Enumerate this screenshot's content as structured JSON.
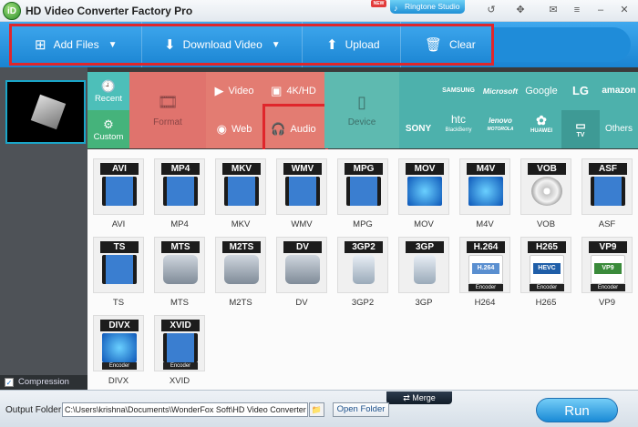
{
  "app": {
    "title": "HD Video Converter Factory Pro",
    "logo": "iD"
  },
  "titlebar": {
    "ringtone_label": "Ringtone Studio",
    "ringtone_badge": "NEW"
  },
  "toolbar": {
    "add_files": "Add Files",
    "download_video": "Download Video",
    "upload": "Upload",
    "clear": "Clear"
  },
  "categories": {
    "recent": "Recent",
    "custom": "Custom",
    "format": "Format",
    "video": "Video",
    "hd": "4K/HD",
    "web": "Web",
    "audio": "Audio",
    "device": "Device",
    "brands_row1": [
      "SAMSUNG",
      "Microsoft",
      "Google",
      "LG",
      "amazon"
    ],
    "brands_row2": [
      "SONY",
      "htc",
      "lenovo",
      "HUAWEI",
      "TV",
      "Others"
    ],
    "htc_sub": "BlackBerry",
    "lenovo_sub": "MOTOROLA"
  },
  "formats": [
    {
      "name": "AVI",
      "label": "AVI"
    },
    {
      "name": "MP4",
      "label": "MP4"
    },
    {
      "name": "MKV",
      "label": "MKV"
    },
    {
      "name": "WMV",
      "label": "WMV"
    },
    {
      "name": "MPG",
      "label": "MPG"
    },
    {
      "name": "MOV",
      "label": "MOV"
    },
    {
      "name": "M4V",
      "label": "M4V"
    },
    {
      "name": "VOB",
      "label": "VOB"
    },
    {
      "name": "ASF",
      "label": "ASF"
    },
    {
      "name": "TS",
      "label": "TS"
    },
    {
      "name": "MTS",
      "label": "MTS"
    },
    {
      "name": "M2TS",
      "label": "M2TS"
    },
    {
      "name": "DV",
      "label": "DV"
    },
    {
      "name": "3GP2",
      "label": "3GP2"
    },
    {
      "name": "3GP",
      "label": "3GP"
    },
    {
      "name": "H.264",
      "label": "H264"
    },
    {
      "name": "H265",
      "label": "H265"
    },
    {
      "name": "VP9",
      "label": "VP9"
    },
    {
      "name": "DIVX",
      "label": "DIVX"
    },
    {
      "name": "XVID",
      "label": "XVID"
    }
  ],
  "codec_art": {
    "h264": "H.264",
    "h265": "HEVC",
    "vp9": "VP9"
  },
  "encoder_tag": "Encoder",
  "compression": "Compression Settings",
  "bottom": {
    "merge": "Merge",
    "output_label": "Output Folder:",
    "output_path": "C:\\Users\\krishna\\Documents\\WonderFox Soft\\HD Video Converter Factory Pro",
    "open_folder": "Open Folder",
    "run": "Run"
  }
}
